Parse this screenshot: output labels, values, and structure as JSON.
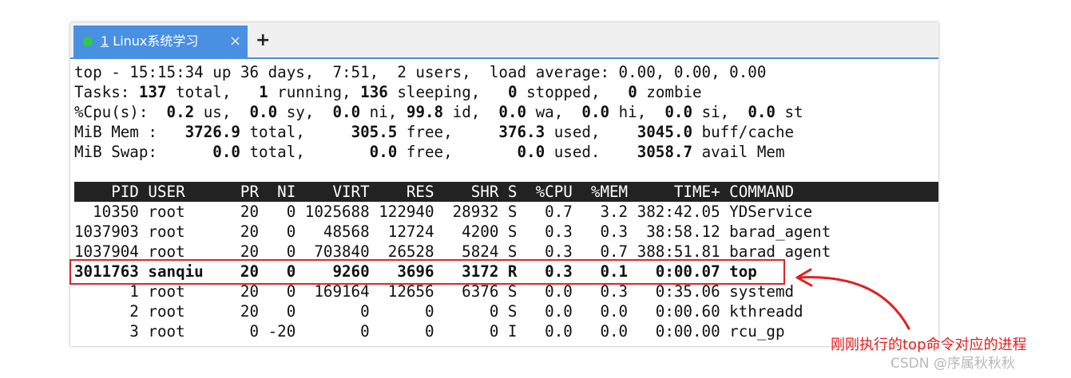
{
  "tab": {
    "title": "1 Linux系统学习",
    "number": "1",
    "name": "Linux系统学习",
    "close": "×",
    "add": "+",
    "status_color": "#2ecc40",
    "accent_color": "#4a90e2"
  },
  "summary": {
    "line1": "top - 15:15:34 up 36 days,  7:51,  2 users,  load average: 0.00, 0.00, 0.00",
    "tasks": {
      "label": "Tasks: ",
      "total": "137",
      "total_l": " total,   ",
      "running": "1",
      "running_l": " running, ",
      "sleeping": "136",
      "sleeping_l": " sleeping,   ",
      "stopped": "0",
      "stopped_l": " stopped,   ",
      "zombie": "0",
      "zombie_l": " zombie"
    },
    "cpu": {
      "label": "%Cpu(s):  ",
      "us": "0.2",
      "us_l": " us,  ",
      "sy": "0.0",
      "sy_l": " sy,  ",
      "ni": "0.0",
      "ni_l": " ni, ",
      "id": "99.8",
      "id_l": " id,  ",
      "wa": "0.0",
      "wa_l": " wa,  ",
      "hi": "0.0",
      "hi_l": " hi,  ",
      "si": "0.0",
      "si_l": " si,  ",
      "st": "0.0",
      "st_l": " st"
    },
    "mem": {
      "label": "MiB Mem :   ",
      "total": "3726.9",
      "total_l": " total,     ",
      "free": "305.5",
      "free_l": " free,     ",
      "used": "376.3",
      "used_l": " used,    ",
      "cache": "3045.0",
      "cache_l": " buff/cache"
    },
    "swap": {
      "label": "MiB Swap:      ",
      "total": "0.0",
      "total_l": " total,       ",
      "free": "0.0",
      "free_l": " free,       ",
      "used": "0.0",
      "used_l": " used.    ",
      "avail": "3058.7",
      "avail_l": " avail Mem"
    }
  },
  "table": {
    "header": "    PID USER      PR  NI    VIRT    RES    SHR S  %CPU  %MEM     TIME+ COMMAND",
    "columns": [
      "PID",
      "USER",
      "PR",
      "NI",
      "VIRT",
      "RES",
      "SHR",
      "S",
      "%CPU",
      "%MEM",
      "TIME+",
      "COMMAND"
    ],
    "rows": [
      {
        "text": "  10350 root      20   0 1025688 122940  28932 S   0.7   3.2 382:42.05 YDService",
        "bold": false
      },
      {
        "text": "1037903 root      20   0   48568  12724   4200 S   0.3   0.3  38:58.12 barad_agent",
        "bold": false
      },
      {
        "text": "1037904 root      20   0  703840  26528   5824 S   0.3   0.7 388:51.81 barad_agent",
        "bold": false
      },
      {
        "text": "3011763 sanqiu    20   0    9260   3696   3172 R   0.3   0.1   0:00.07 top",
        "bold": true
      },
      {
        "text": "      1 root      20   0  169164  12656   6376 S   0.0   0.3   0:35.06 systemd",
        "bold": false
      },
      {
        "text": "      2 root      20   0       0      0      0 S   0.0   0.0   0:00.60 kthreadd",
        "bold": false
      },
      {
        "text": "      3 root       0 -20       0      0      0 I   0.0   0.0   0:00.00 rcu_gp",
        "bold": false
      }
    ]
  },
  "annotation": {
    "text": "刚刚执行的top命令对应的进程",
    "color": "#e02020"
  },
  "watermark": "CSDN @序属秋秋秋"
}
